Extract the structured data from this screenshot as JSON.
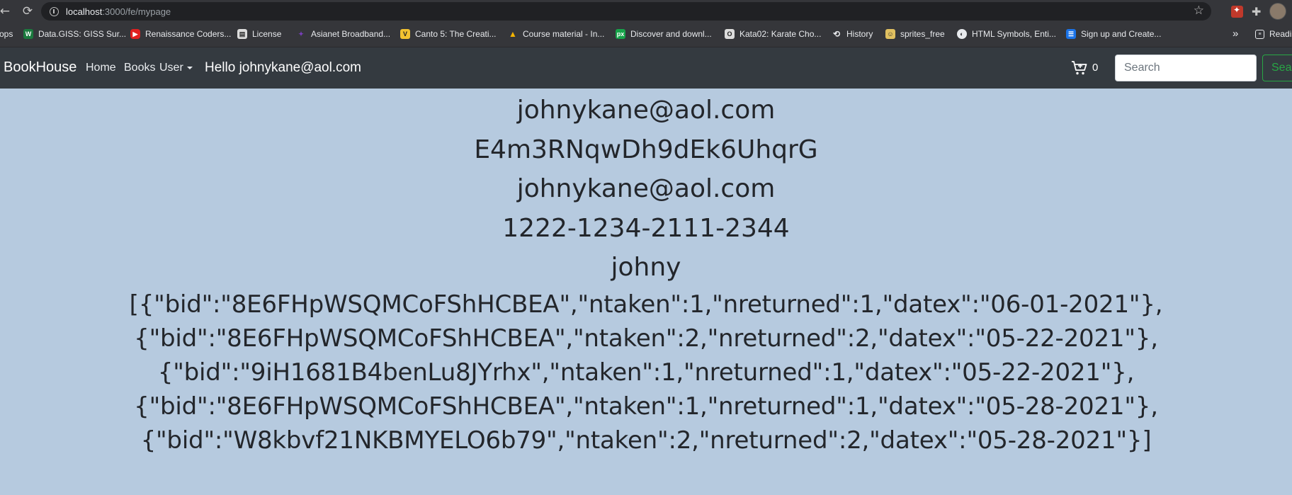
{
  "browser": {
    "url_host": "localhost",
    "url_path": ":3000/fe/mypage"
  },
  "bookmarks": [
    {
      "label": "ops",
      "icon": "apps-icon"
    },
    {
      "label": "Data.GISS: GISS Sur...",
      "icon": "giss-icon"
    },
    {
      "label": "Renaissance Coders...",
      "icon": "youtube-icon"
    },
    {
      "label": "License",
      "icon": "document-icon"
    },
    {
      "label": "Asianet Broadband...",
      "icon": "asianet-icon"
    },
    {
      "label": "Canto 5: The Creati...",
      "icon": "canto-icon"
    },
    {
      "label": "Course material - In...",
      "icon": "drive-icon"
    },
    {
      "label": "Discover and downl...",
      "icon": "px-icon"
    },
    {
      "label": "Kata02: Karate Cho...",
      "icon": "kata-icon"
    },
    {
      "label": "History",
      "icon": "history-icon"
    },
    {
      "label": "sprites_free",
      "icon": "sprites-icon"
    },
    {
      "label": "HTML Symbols, Enti...",
      "icon": "globe-icon"
    },
    {
      "label": "Sign up and Create...",
      "icon": "form-icon"
    }
  ],
  "bookmarks_more": "»",
  "reading_list": "Readi",
  "navbar": {
    "brand": "BookHouse",
    "home": "Home",
    "books": "Books",
    "user": "User",
    "greeting": "Hello johnykane@aol.com",
    "cart_count": "0",
    "search_placeholder": "Search",
    "search_button": "Search"
  },
  "profile": {
    "email": "johnykane@aol.com",
    "uid": "E4m3RNqwDh9dEk6UhqrG",
    "email2": "johnykane@aol.com",
    "card": "1222-1234-2111-2344",
    "name": "johny"
  },
  "history_lines": [
    "[{\"bid\":\"8E6FHpWSQMCoFShHCBEA\",\"ntaken\":1,\"nreturned\":1,\"datex\":\"06-01-2021\"},",
    "{\"bid\":\"8E6FHpWSQMCoFShHCBEA\",\"ntaken\":2,\"nreturned\":2,\"datex\":\"05-22-2021\"},",
    "{\"bid\":\"9iH1681B4benLu8JYrhx\",\"ntaken\":1,\"nreturned\":1,\"datex\":\"05-22-2021\"},",
    "{\"bid\":\"8E6FHpWSQMCoFShHCBEA\",\"ntaken\":1,\"nreturned\":1,\"datex\":\"05-28-2021\"},",
    "{\"bid\":\"W8kbvf21NKBMYELO6b79\",\"ntaken\":2,\"nreturned\":2,\"datex\":\"05-28-2021\"}]"
  ]
}
